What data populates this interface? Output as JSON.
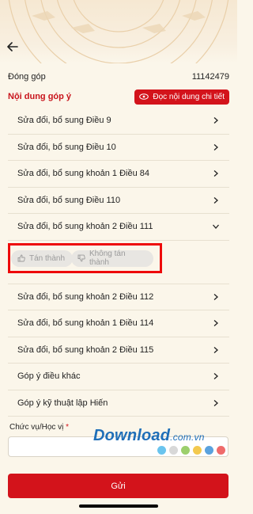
{
  "header": {
    "contribution_label": "Đóng góp",
    "contribution_id": "11142479"
  },
  "section": {
    "title": "Nội dung góp ý",
    "read_button_label": "Đọc nội dung chi tiết"
  },
  "items_before": [
    {
      "label": "Sửa đổi, bổ sung Điều 9"
    },
    {
      "label": "Sửa đổi, bổ sung Điều 10"
    },
    {
      "label": "Sửa đổi, bổ sung khoản 1 Điều 84"
    },
    {
      "label": "Sửa đổi, bổ sung Điều 110"
    },
    {
      "label": "Sửa đổi, bổ sung khoản 2 Điều 111"
    }
  ],
  "vote": {
    "agree_label": "Tán thành",
    "disagree_label": "Không tán thành"
  },
  "items_after": [
    {
      "label": "Sửa đổi, bổ sung khoản 2 Điều 112"
    },
    {
      "label": "Sửa đổi, bổ sung khoản 1 Điều 114"
    },
    {
      "label": "Sửa đổi, bổ sung khoản 2 Điều 115"
    },
    {
      "label": "Góp ý điều khác"
    },
    {
      "label": "Góp ý kỹ thuật lập Hiến"
    }
  ],
  "form": {
    "position_label": "Chức vụ/Học vị",
    "required_mark": "*",
    "position_value": "",
    "submit_label": "Gửi"
  },
  "watermark": {
    "brand": "Download",
    "suffix": ".com.vn",
    "dot_colors": [
      "#6ac4ee",
      "#d8d8d8",
      "#9ccf6c",
      "#f3c94f",
      "#5aa2de",
      "#ef6b6b"
    ]
  },
  "colors": {
    "accent": "#d3131b",
    "highlight_box": "#ee0a0a",
    "background": "#fbf6ea"
  }
}
